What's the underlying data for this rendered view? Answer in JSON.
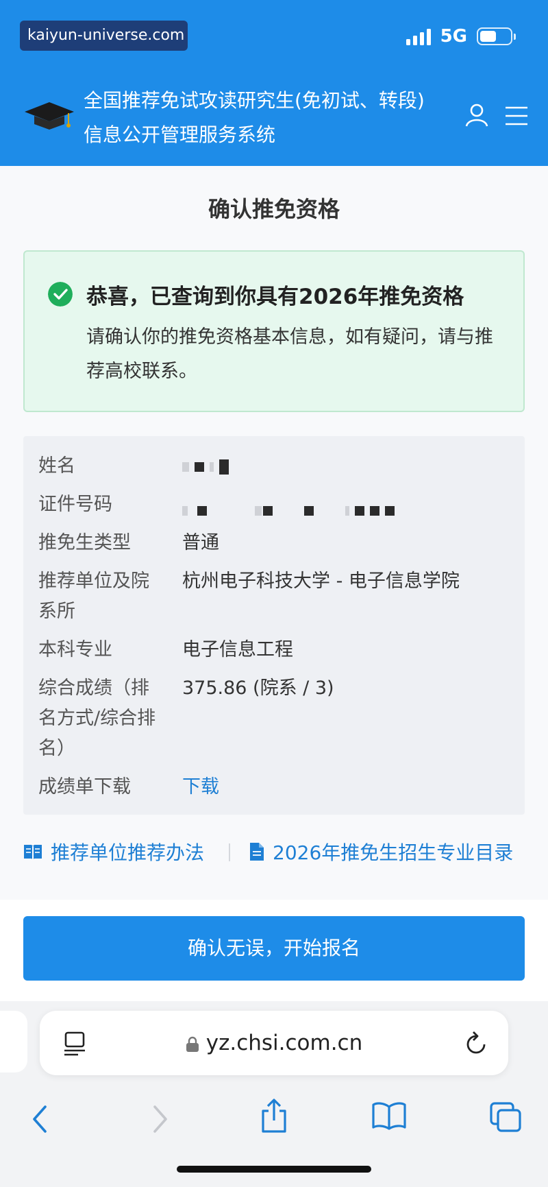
{
  "status_bar": {
    "watermark": "kaiyun-universe.com",
    "network": "5G",
    "battery_level": 0.55,
    "signal_bars": 4
  },
  "header": {
    "title_line1": "全国推荐免试攻读研究生(免初试、转段)",
    "title_line2": "信息公开管理服务系统"
  },
  "page": {
    "title": "确认推免资格"
  },
  "success": {
    "title": "恭喜，已查询到你具有2026年推免资格",
    "description": "请确认你的推免资格基本信息，如有疑问，请与推荐高校联系。"
  },
  "info": {
    "rows": [
      {
        "label": "姓名",
        "value": ""
      },
      {
        "label": "证件号码",
        "value": ""
      },
      {
        "label": "推免生类型",
        "value": "普通"
      },
      {
        "label": "推荐单位及院系所",
        "value": "杭州电子科技大学 - 电子信息学院"
      },
      {
        "label": "本科专业",
        "value": "电子信息工程"
      },
      {
        "label": "综合成绩（排名方式/综合排名）",
        "value": "375.86 (院系 / 3)"
      },
      {
        "label": "成绩单下载",
        "value": "下载"
      }
    ]
  },
  "links": {
    "method": "推荐单位推荐办法",
    "catalog": "2026年推免生招生专业目录"
  },
  "cta": {
    "label": "确认无误，开始报名"
  },
  "browser": {
    "url": "yz.chsi.com.cn"
  },
  "colors": {
    "brand_blue": "#1e8ce8",
    "success_green": "#1fae5b",
    "link_blue": "#1e7fd4"
  }
}
